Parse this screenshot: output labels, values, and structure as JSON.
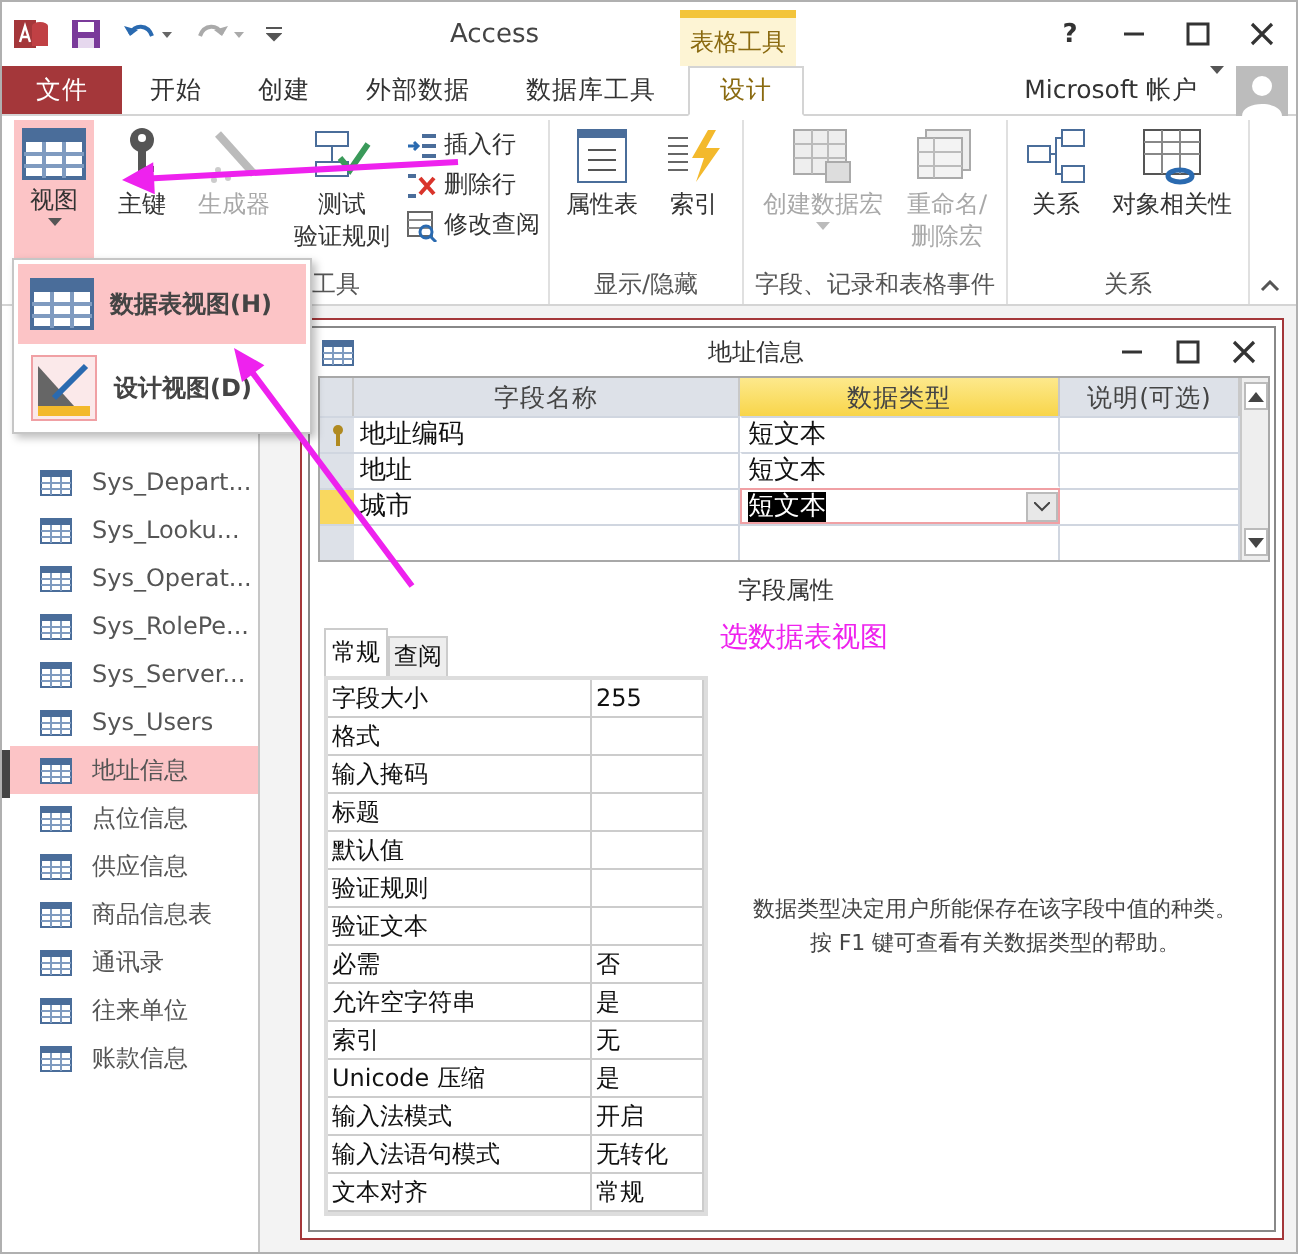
{
  "window": {
    "title": "Access",
    "contextual_tab_group": "表格工具",
    "help_label": "?"
  },
  "ribbon_tabs": [
    {
      "label": "文件",
      "kind": "file",
      "selected": false
    },
    {
      "label": "开始",
      "kind": "tab",
      "selected": false
    },
    {
      "label": "创建",
      "kind": "tab",
      "selected": false
    },
    {
      "label": "外部数据",
      "kind": "tab",
      "selected": false
    },
    {
      "label": "数据库工具",
      "kind": "tab",
      "selected": false
    },
    {
      "label": "设计",
      "kind": "contextual",
      "selected": true
    }
  ],
  "account": "Microsoft 帐户",
  "ribbon_groups": [
    {
      "label": "工具",
      "buttons": [
        {
          "lines": [
            "视图"
          ],
          "kind": "large",
          "pressed": true,
          "disabled": false,
          "dropdown": true
        },
        {
          "lines": [
            "主键"
          ],
          "kind": "large",
          "pressed": false,
          "disabled": false,
          "dropdown": false
        },
        {
          "lines": [
            "生成器"
          ],
          "kind": "large",
          "pressed": false,
          "disabled": true,
          "dropdown": false
        },
        {
          "lines": [
            "测试",
            "验证规则"
          ],
          "kind": "large",
          "pressed": false,
          "disabled": false,
          "dropdown": false
        },
        {
          "lines": [
            "插入行"
          ],
          "kind": "small",
          "disabled": false
        },
        {
          "lines": [
            "删除行"
          ],
          "kind": "small",
          "disabled": false
        },
        {
          "lines": [
            "修改查阅"
          ],
          "kind": "small",
          "disabled": false
        }
      ]
    },
    {
      "label": "显示/隐藏",
      "buttons": [
        {
          "lines": [
            "属性表"
          ],
          "kind": "large",
          "pressed": false,
          "disabled": false,
          "dropdown": false
        },
        {
          "lines": [
            "索引"
          ],
          "kind": "large",
          "pressed": false,
          "disabled": false,
          "dropdown": false
        }
      ]
    },
    {
      "label": "字段、记录和表格事件",
      "buttons": [
        {
          "lines": [
            "创建数据宏"
          ],
          "kind": "large",
          "pressed": false,
          "disabled": true,
          "dropdown": true
        },
        {
          "lines": [
            "重命名/",
            "删除宏"
          ],
          "kind": "large",
          "pressed": false,
          "disabled": true,
          "dropdown": false
        }
      ]
    },
    {
      "label": "关系",
      "buttons": [
        {
          "lines": [
            "关系"
          ],
          "kind": "large",
          "pressed": false,
          "disabled": false,
          "dropdown": false
        },
        {
          "lines": [
            "对象相关性"
          ],
          "kind": "large",
          "pressed": false,
          "disabled": false,
          "dropdown": false
        }
      ]
    }
  ],
  "view_menu": {
    "items": [
      {
        "label": "数据表视图(H)",
        "selected": true
      },
      {
        "label": "设计视图(D)",
        "selected": false
      }
    ]
  },
  "navigation": {
    "items": [
      {
        "label": "Sys_Depart...",
        "selected": false
      },
      {
        "label": "Sys_Looku...",
        "selected": false
      },
      {
        "label": "Sys_Operat...",
        "selected": false
      },
      {
        "label": "Sys_RolePe...",
        "selected": false
      },
      {
        "label": "Sys_Server...",
        "selected": false
      },
      {
        "label": "Sys_Users",
        "selected": false
      },
      {
        "label": "地址信息",
        "selected": true
      },
      {
        "label": "点位信息",
        "selected": false
      },
      {
        "label": "供应信息",
        "selected": false
      },
      {
        "label": "商品信息表",
        "selected": false
      },
      {
        "label": "通讯录",
        "selected": false
      },
      {
        "label": "往来单位",
        "selected": false
      },
      {
        "label": "账款信息",
        "selected": false
      }
    ]
  },
  "document": {
    "title": "地址信息",
    "columns": [
      {
        "label": "字段名称",
        "selected": false
      },
      {
        "label": "数据类型",
        "selected": true
      },
      {
        "label": "说明(可选)",
        "selected": false
      }
    ],
    "rows": [
      {
        "field_name": "地址编码",
        "data_type": "短文本",
        "primary_key": true,
        "selected": false
      },
      {
        "field_name": "地址",
        "data_type": "短文本",
        "primary_key": false,
        "selected": false
      },
      {
        "field_name": "城市",
        "data_type": "短文本",
        "primary_key": false,
        "selected": true
      }
    ],
    "properties_caption": "字段属性",
    "property_tabs": [
      {
        "label": "常规",
        "selected": true
      },
      {
        "label": "查阅",
        "selected": false
      }
    ],
    "properties": [
      {
        "name": "字段大小",
        "value": "255"
      },
      {
        "name": "格式"
      },
      {
        "name": "输入掩码"
      },
      {
        "name": "标题"
      },
      {
        "name": "默认值"
      },
      {
        "name": "验证规则"
      },
      {
        "name": "验证文本"
      },
      {
        "name": "必需",
        "value": "否"
      },
      {
        "name": "允许空字符串",
        "value": "是"
      },
      {
        "name": "索引",
        "value": "无"
      },
      {
        "name": "Unicode 压缩",
        "value": "是"
      },
      {
        "name": "输入法模式",
        "value": "开启"
      },
      {
        "name": "输入法语句模式",
        "value": "无转化"
      },
      {
        "name": "文本对齐",
        "value": "常规"
      }
    ],
    "help_text": "数据类型决定用户所能保存在该字段中值的种类。按 F1 键可查看有关数据类型的帮助。"
  },
  "annotation": {
    "text": "选数据表视图"
  }
}
